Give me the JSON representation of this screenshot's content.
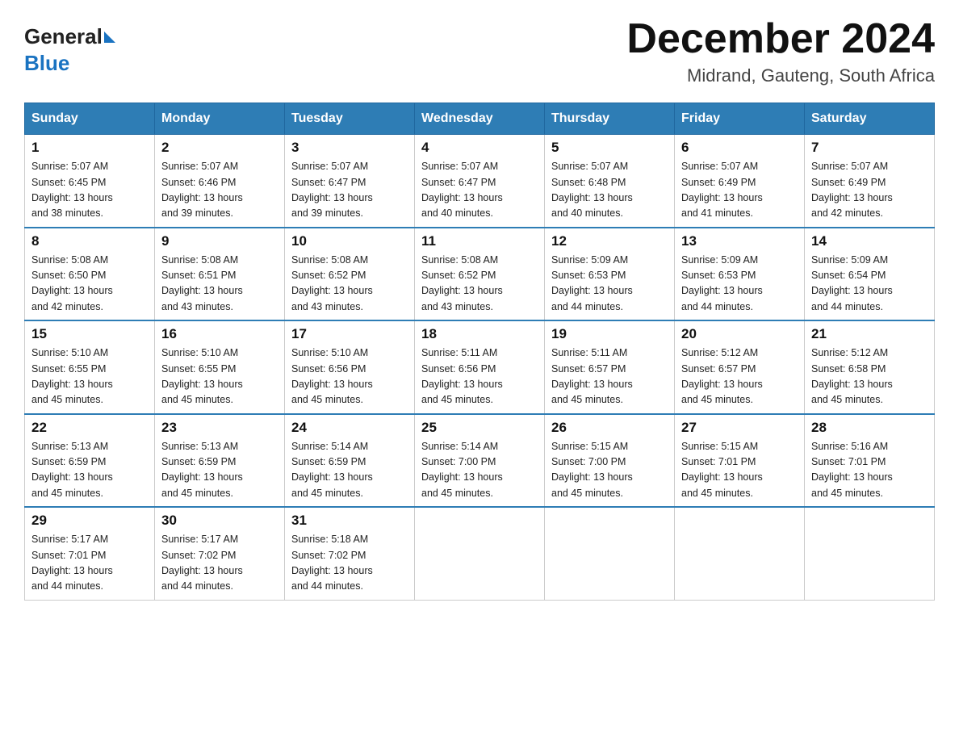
{
  "header": {
    "logo_general": "General",
    "logo_blue": "Blue",
    "month_title": "December 2024",
    "location": "Midrand, Gauteng, South Africa"
  },
  "weekdays": [
    "Sunday",
    "Monday",
    "Tuesday",
    "Wednesday",
    "Thursday",
    "Friday",
    "Saturday"
  ],
  "weeks": [
    [
      {
        "day": "1",
        "sunrise": "5:07 AM",
        "sunset": "6:45 PM",
        "daylight": "13 hours and 38 minutes."
      },
      {
        "day": "2",
        "sunrise": "5:07 AM",
        "sunset": "6:46 PM",
        "daylight": "13 hours and 39 minutes."
      },
      {
        "day": "3",
        "sunrise": "5:07 AM",
        "sunset": "6:47 PM",
        "daylight": "13 hours and 39 minutes."
      },
      {
        "day": "4",
        "sunrise": "5:07 AM",
        "sunset": "6:47 PM",
        "daylight": "13 hours and 40 minutes."
      },
      {
        "day": "5",
        "sunrise": "5:07 AM",
        "sunset": "6:48 PM",
        "daylight": "13 hours and 40 minutes."
      },
      {
        "day": "6",
        "sunrise": "5:07 AM",
        "sunset": "6:49 PM",
        "daylight": "13 hours and 41 minutes."
      },
      {
        "day": "7",
        "sunrise": "5:07 AM",
        "sunset": "6:49 PM",
        "daylight": "13 hours and 42 minutes."
      }
    ],
    [
      {
        "day": "8",
        "sunrise": "5:08 AM",
        "sunset": "6:50 PM",
        "daylight": "13 hours and 42 minutes."
      },
      {
        "day": "9",
        "sunrise": "5:08 AM",
        "sunset": "6:51 PM",
        "daylight": "13 hours and 43 minutes."
      },
      {
        "day": "10",
        "sunrise": "5:08 AM",
        "sunset": "6:52 PM",
        "daylight": "13 hours and 43 minutes."
      },
      {
        "day": "11",
        "sunrise": "5:08 AM",
        "sunset": "6:52 PM",
        "daylight": "13 hours and 43 minutes."
      },
      {
        "day": "12",
        "sunrise": "5:09 AM",
        "sunset": "6:53 PM",
        "daylight": "13 hours and 44 minutes."
      },
      {
        "day": "13",
        "sunrise": "5:09 AM",
        "sunset": "6:53 PM",
        "daylight": "13 hours and 44 minutes."
      },
      {
        "day": "14",
        "sunrise": "5:09 AM",
        "sunset": "6:54 PM",
        "daylight": "13 hours and 44 minutes."
      }
    ],
    [
      {
        "day": "15",
        "sunrise": "5:10 AM",
        "sunset": "6:55 PM",
        "daylight": "13 hours and 45 minutes."
      },
      {
        "day": "16",
        "sunrise": "5:10 AM",
        "sunset": "6:55 PM",
        "daylight": "13 hours and 45 minutes."
      },
      {
        "day": "17",
        "sunrise": "5:10 AM",
        "sunset": "6:56 PM",
        "daylight": "13 hours and 45 minutes."
      },
      {
        "day": "18",
        "sunrise": "5:11 AM",
        "sunset": "6:56 PM",
        "daylight": "13 hours and 45 minutes."
      },
      {
        "day": "19",
        "sunrise": "5:11 AM",
        "sunset": "6:57 PM",
        "daylight": "13 hours and 45 minutes."
      },
      {
        "day": "20",
        "sunrise": "5:12 AM",
        "sunset": "6:57 PM",
        "daylight": "13 hours and 45 minutes."
      },
      {
        "day": "21",
        "sunrise": "5:12 AM",
        "sunset": "6:58 PM",
        "daylight": "13 hours and 45 minutes."
      }
    ],
    [
      {
        "day": "22",
        "sunrise": "5:13 AM",
        "sunset": "6:59 PM",
        "daylight": "13 hours and 45 minutes."
      },
      {
        "day": "23",
        "sunrise": "5:13 AM",
        "sunset": "6:59 PM",
        "daylight": "13 hours and 45 minutes."
      },
      {
        "day": "24",
        "sunrise": "5:14 AM",
        "sunset": "6:59 PM",
        "daylight": "13 hours and 45 minutes."
      },
      {
        "day": "25",
        "sunrise": "5:14 AM",
        "sunset": "7:00 PM",
        "daylight": "13 hours and 45 minutes."
      },
      {
        "day": "26",
        "sunrise": "5:15 AM",
        "sunset": "7:00 PM",
        "daylight": "13 hours and 45 minutes."
      },
      {
        "day": "27",
        "sunrise": "5:15 AM",
        "sunset": "7:01 PM",
        "daylight": "13 hours and 45 minutes."
      },
      {
        "day": "28",
        "sunrise": "5:16 AM",
        "sunset": "7:01 PM",
        "daylight": "13 hours and 45 minutes."
      }
    ],
    [
      {
        "day": "29",
        "sunrise": "5:17 AM",
        "sunset": "7:01 PM",
        "daylight": "13 hours and 44 minutes."
      },
      {
        "day": "30",
        "sunrise": "5:17 AM",
        "sunset": "7:02 PM",
        "daylight": "13 hours and 44 minutes."
      },
      {
        "day": "31",
        "sunrise": "5:18 AM",
        "sunset": "7:02 PM",
        "daylight": "13 hours and 44 minutes."
      },
      null,
      null,
      null,
      null
    ]
  ],
  "labels": {
    "sunrise": "Sunrise:",
    "sunset": "Sunset:",
    "daylight": "Daylight:"
  }
}
